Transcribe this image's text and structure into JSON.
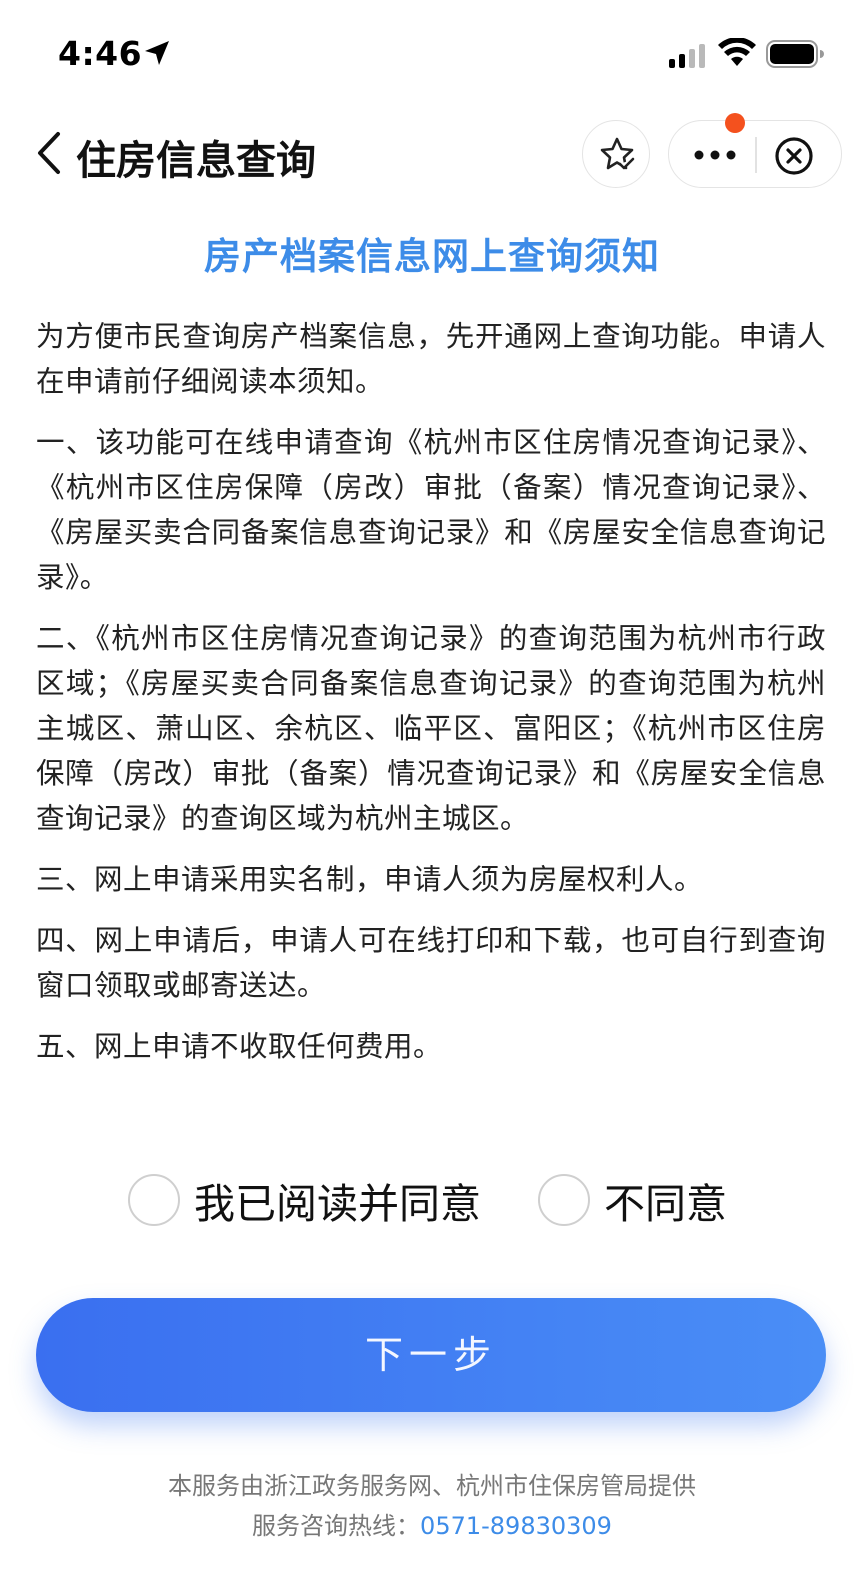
{
  "status_bar": {
    "time": "4:46"
  },
  "nav": {
    "title": "住房信息查询"
  },
  "notice": {
    "title": "房产档案信息网上查询须知",
    "paragraphs": [
      "为方便市民查询房产档案信息，先开通网上查询功能。申请人在申请前仔细阅读本须知。",
      "一、该功能可在线申请查询《杭州市区住房情况查询记录》、《杭州市区住房保障（房改）审批（备案）情况查询记录》、《房屋买卖合同备案信息查询记录》和《房屋安全信息查询记录》。",
      "二、《杭州市区住房情况查询记录》的查询范围为杭州市行政区域；《房屋买卖合同备案信息查询记录》的查询范围为杭州主城区、萧山区、余杭区、临平区、富阳区；《杭州市区住房保障（房改）审批（备案）情况查询记录》和《房屋安全信息查询记录》的查询区域为杭州主城区。",
      "三、网上申请采用实名制，申请人须为房屋权利人。",
      "四、网上申请后，申请人可在线打印和下载，也可自行到查询窗口领取或邮寄送达。",
      "五、网上申请不收取任何费用。"
    ]
  },
  "agreement": {
    "agree_label": "我已阅读并同意",
    "disagree_label": "不同意"
  },
  "next_button": {
    "label": "下一步"
  },
  "footer": {
    "provider": "本服务由浙江政务服务网、杭州市住保房管局提供",
    "hotline_label": "服务咨询热线：",
    "hotline_number": "0571-89830309"
  },
  "colors": {
    "accent": "#3d8ce8",
    "button_start": "#3a6ff0",
    "button_end": "#4a8ef6",
    "notification_dot": "#f4511e"
  }
}
